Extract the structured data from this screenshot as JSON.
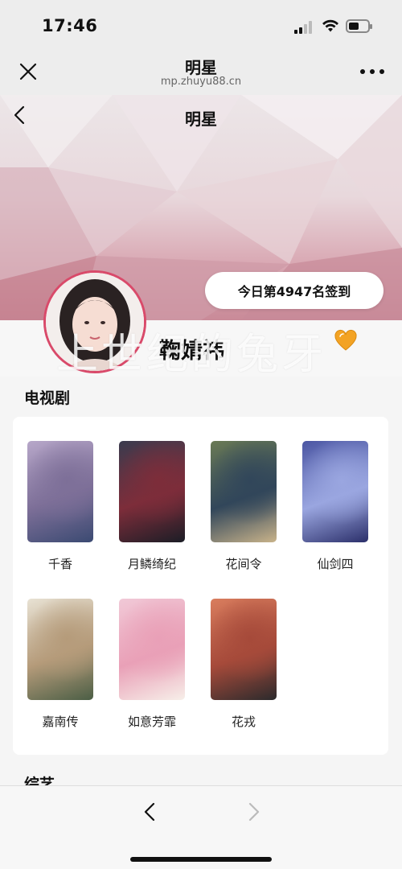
{
  "status_bar": {
    "time": "17:46",
    "battery_level": 0.55
  },
  "nav": {
    "title": "明星",
    "url": "mp.zhuyu88.cn"
  },
  "page": {
    "title": "明星",
    "checkin_text": "今日第4947名签到",
    "star_name": "鞠婧祎",
    "watermark": "上世纪的兔牙"
  },
  "sections": {
    "tv_title": "电视剧",
    "variety_title": "综艺"
  },
  "tv_shows": [
    {
      "title": "千香",
      "colors": [
        "#b7a7c9",
        "#7d6f98",
        "#3b4a72"
      ]
    },
    {
      "title": "月鳞绮纪",
      "colors": [
        "#3a3b4e",
        "#7d2d3a",
        "#1b1d26"
      ]
    },
    {
      "title": "花间令",
      "colors": [
        "#6a7a55",
        "#31465a",
        "#c9b38a"
      ]
    },
    {
      "title": "仙剑四",
      "colors": [
        "#4b56a3",
        "#9aa6e0",
        "#2b2f6a"
      ]
    },
    {
      "title": "嘉南传",
      "colors": [
        "#e8e2d4",
        "#b59b7a",
        "#4b5e45"
      ]
    },
    {
      "title": "如意芳霏",
      "colors": [
        "#f1c9d7",
        "#e9a0b7",
        "#f7efe9"
      ]
    },
    {
      "title": "花戎",
      "colors": [
        "#d97d5e",
        "#a64a3a",
        "#2b2a2c"
      ]
    }
  ]
}
